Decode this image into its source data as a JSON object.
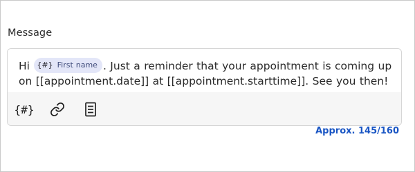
{
  "field": {
    "label": "Message"
  },
  "message": {
    "part1": "Hi ",
    "chip": {
      "icon_text": "{#}",
      "label": "First name"
    },
    "part2": ". Just a reminder that your appointment is coming up on [[appointment.date]] at [[appointment.starttime]]. See you then!"
  },
  "toolbar": {
    "variable_icon_text": "{#}",
    "items": [
      {
        "name": "insert-variable",
        "icon": "braces-hash-icon"
      },
      {
        "name": "insert-link",
        "icon": "link-icon"
      },
      {
        "name": "insert-template",
        "icon": "document-icon"
      }
    ]
  },
  "counter": {
    "text": "Approx. 145/160"
  },
  "colors": {
    "accent": "#1a56c4",
    "chip_bg": "#e3e6f8",
    "toolbar_bg": "#f6f6f6"
  }
}
